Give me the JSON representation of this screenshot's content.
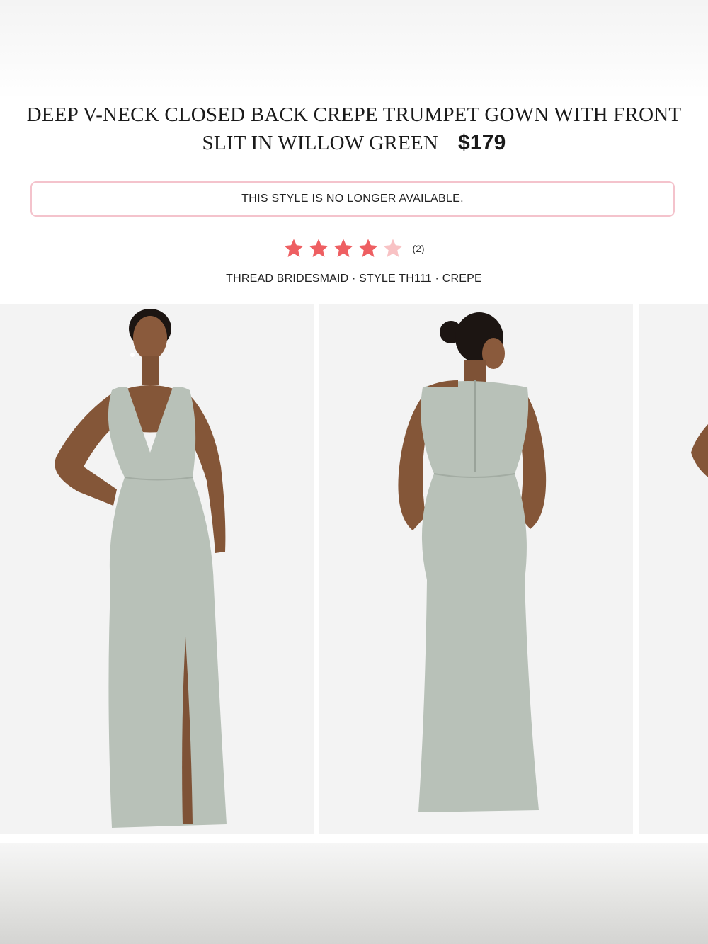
{
  "product": {
    "title": "DEEP V-NECK CLOSED BACK CREPE TRUMPET GOWN WITH FRONT SLIT IN WILLOW GREEN",
    "price": "$179",
    "availability_notice": "THIS STYLE IS NO LONGER AVAILABLE.",
    "rating": {
      "value": 4,
      "max": 5,
      "review_count": "(2)"
    },
    "meta_line": "THREAD BRIDESMAID · STYLE TH111 · CREPE"
  },
  "gallery": {
    "images": [
      {
        "view": "front"
      },
      {
        "view": "back"
      },
      {
        "view": "side"
      }
    ]
  },
  "colors": {
    "star_filled": "#ee5f62",
    "star_empty": "#f8c2c4",
    "notice_border": "#f4c3cc",
    "dress": "#b8c1b8",
    "skin": "#8a5a3c"
  }
}
